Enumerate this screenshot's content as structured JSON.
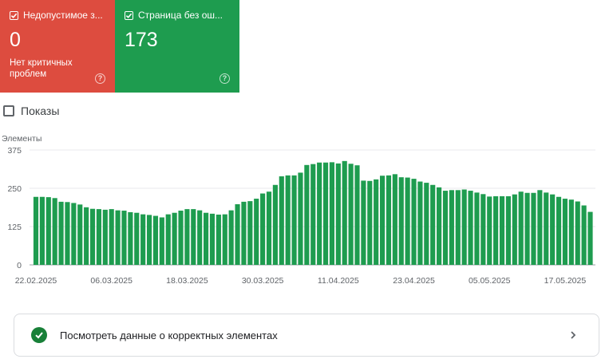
{
  "cards": [
    {
      "label": "Недопустимое з...",
      "value": "0",
      "sub": "Нет критичных проблем",
      "color": "#dd4c3f",
      "checked": true
    },
    {
      "label": "Страница без ош...",
      "value": "173",
      "color": "#1e9c4f",
      "checked": true
    }
  ],
  "toggle": {
    "label": "Показы",
    "checked": false
  },
  "chart_data": {
    "type": "bar",
    "ylabel": "Элементы",
    "ylim": [
      0,
      375
    ],
    "yticks": [
      "375",
      "250",
      "125",
      "0"
    ],
    "grid": true,
    "color": "#1e9c4f",
    "xticks": [
      "22.02.2025",
      "06.03.2025",
      "18.03.2025",
      "30.03.2025",
      "11.04.2025",
      "23.04.2025",
      "05.05.2025",
      "17.05.2025"
    ],
    "values": [
      222,
      222,
      221,
      218,
      206,
      205,
      202,
      197,
      188,
      183,
      182,
      180,
      182,
      178,
      177,
      172,
      170,
      165,
      163,
      160,
      155,
      165,
      170,
      177,
      182,
      182,
      178,
      170,
      167,
      164,
      165,
      178,
      198,
      206,
      208,
      216,
      233,
      239,
      261,
      289,
      292,
      292,
      301,
      326,
      329,
      334,
      334,
      335,
      331,
      339,
      330,
      325,
      275,
      274,
      279,
      291,
      292,
      296,
      286,
      285,
      281,
      272,
      268,
      261,
      253,
      242,
      244,
      244,
      246,
      242,
      236,
      231,
      223,
      224,
      224,
      224,
      230,
      239,
      235,
      235,
      244,
      236,
      230,
      222,
      216,
      213,
      207,
      194,
      173
    ]
  },
  "footer": {
    "label": "Посмотреть данные о корректных элементах"
  }
}
